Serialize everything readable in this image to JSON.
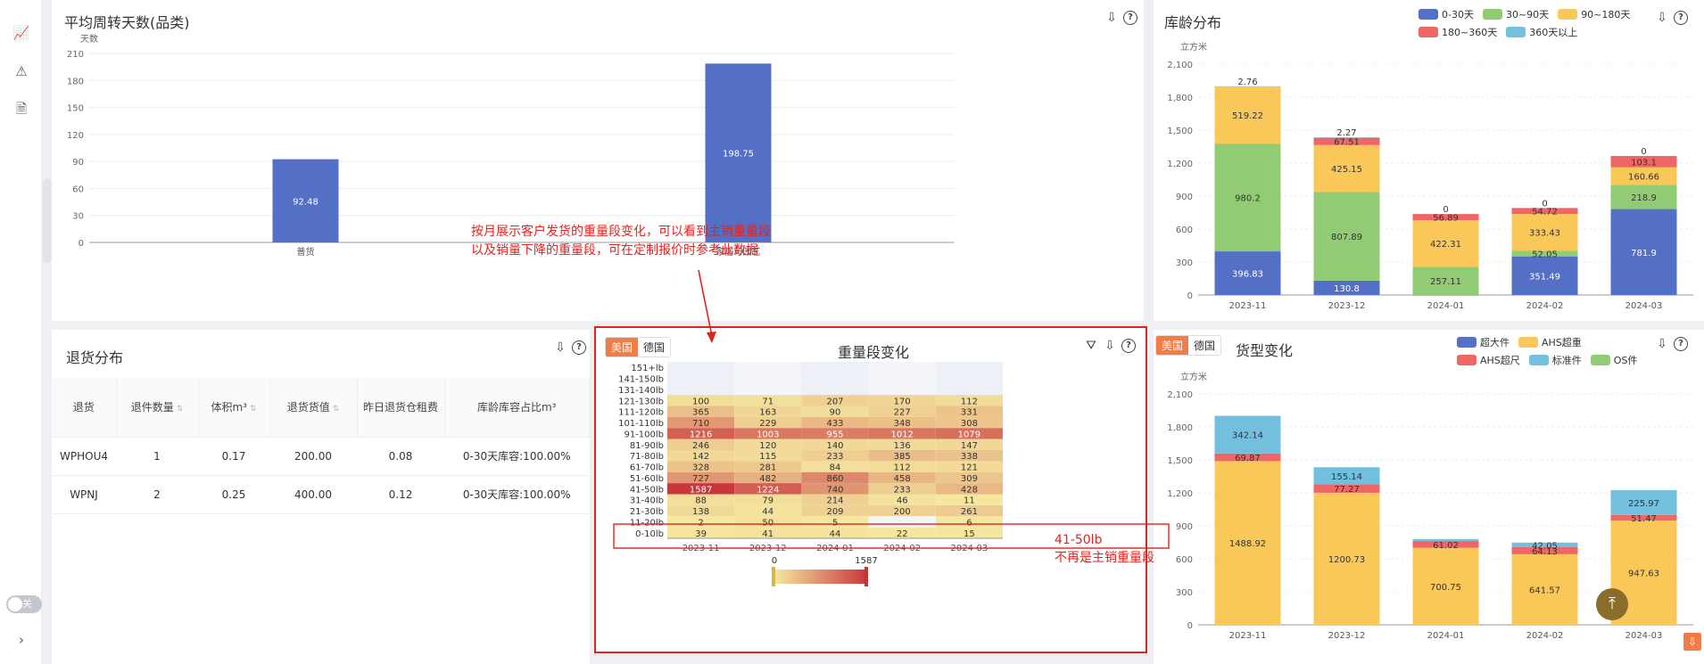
{
  "sidebar": {
    "toggle_label": "关",
    "icons": [
      "line-chart-icon",
      "alert-icon",
      "report-icon",
      "expand-icon"
    ]
  },
  "turnover": {
    "title": "平均周转天数(品类)",
    "ylabel": "天数"
  },
  "aging": {
    "title": "库龄分布",
    "ylabel": "立方米"
  },
  "returns": {
    "title": "退货分布",
    "columns": [
      "退货",
      "退件数量",
      "体积m³",
      "退货货值",
      "昨日退货仓租费",
      "库龄库容占比m³"
    ],
    "rows": [
      [
        "WPHOU4",
        "1",
        "0.17",
        "200.00",
        "0.08",
        "0-30天库容:100.00%"
      ],
      [
        "WPNJ",
        "2",
        "0.25",
        "400.00",
        "0.12",
        "0-30天库容:100.00%"
      ]
    ]
  },
  "weight": {
    "title": "重量段变化",
    "tabs": [
      "美国",
      "德国"
    ],
    "scale_min": "0",
    "scale_max": "1587"
  },
  "cargo": {
    "title": "货型变化",
    "tabs": [
      "美国",
      "德国"
    ],
    "ylabel": "立方米"
  },
  "annotations": {
    "main": "按月展示客户发货的重量段变化，可以看到主销重量段\n以及销量下降的重量段，可在定制报价时参考此数据",
    "side": "41-50lb\n不再是主销重量段"
  },
  "chart_data": [
    {
      "id": "turnover",
      "type": "bar",
      "title": "平均周转天数(品类)",
      "ylabel": "天数",
      "categories": [
        "普货",
        "家居与园艺"
      ],
      "values": [
        92.48,
        198.75
      ],
      "ylim": [
        0,
        210
      ],
      "ticks": [
        0,
        30,
        60,
        90,
        120,
        150,
        180,
        210
      ],
      "color": "#5470c6"
    },
    {
      "id": "aging",
      "type": "bar",
      "stacked": true,
      "title": "库龄分布",
      "ylabel": "立方米",
      "categories": [
        "2023-11",
        "2023-12",
        "2024-01",
        "2024-02",
        "2024-03"
      ],
      "ylim": [
        0,
        2100
      ],
      "ticks": [
        0,
        300,
        600,
        900,
        1200,
        1500,
        1800,
        2100
      ],
      "series": [
        {
          "name": "0-30天",
          "color": "#5470c6",
          "values": [
            396.83,
            130.8,
            0.35,
            351.49,
            781.9
          ]
        },
        {
          "name": "30~90天",
          "color": "#91cc75",
          "values": [
            980.2,
            807.89,
            257.11,
            52.05,
            218.9
          ]
        },
        {
          "name": "90~180天",
          "color": "#fac858",
          "values": [
            519.22,
            425.15,
            422.31,
            333.43,
            160.66
          ]
        },
        {
          "name": "180~360天",
          "color": "#ee6666",
          "values": [
            0,
            67.51,
            56.89,
            54.72,
            103.1
          ]
        },
        {
          "name": "360天以上",
          "color": "#73c0de",
          "values": [
            2.76,
            2.27,
            0,
            0,
            0
          ]
        }
      ],
      "top_labels": [
        "2.76",
        "2.27",
        "0",
        "0",
        "0"
      ]
    },
    {
      "id": "weight",
      "type": "heatmap",
      "title": "重量段变化",
      "x": [
        "2023-11",
        "2023-12",
        "2024-01",
        "2024-02",
        "2024-03"
      ],
      "y": [
        "151+lb",
        "141-150lb",
        "131-140lb",
        "121-130lb",
        "111-120lb",
        "101-110lb",
        "91-100lb",
        "81-90lb",
        "71-80lb",
        "61-70lb",
        "51-60lb",
        "41-50lb",
        "31-40lb",
        "21-30lb",
        "11-20lb",
        "0-10lb"
      ],
      "values": [
        [
          null,
          null,
          null,
          null,
          null
        ],
        [
          null,
          null,
          null,
          null,
          null
        ],
        [
          null,
          null,
          null,
          null,
          null
        ],
        [
          100,
          71,
          207,
          170,
          112
        ],
        [
          365,
          163,
          90,
          227,
          331
        ],
        [
          710,
          229,
          433,
          348,
          308
        ],
        [
          1216,
          1003,
          955,
          1012,
          1079
        ],
        [
          246,
          120,
          140,
          136,
          147
        ],
        [
          142,
          115,
          233,
          385,
          338
        ],
        [
          328,
          281,
          84,
          112,
          121
        ],
        [
          727,
          482,
          860,
          458,
          309
        ],
        [
          1587,
          1224,
          740,
          233,
          428
        ],
        [
          88,
          79,
          214,
          46,
          11
        ],
        [
          138,
          44,
          209,
          200,
          261
        ],
        [
          2,
          50,
          5,
          null,
          6
        ],
        [
          39,
          41,
          44,
          22,
          15
        ]
      ],
      "min": 0,
      "max": 1587
    },
    {
      "id": "cargo",
      "type": "bar",
      "stacked": true,
      "title": "货型变化",
      "ylabel": "立方米",
      "categories": [
        "2023-11",
        "2023-12",
        "2024-01",
        "2024-02",
        "2024-03"
      ],
      "ylim": [
        0,
        2100
      ],
      "ticks": [
        0,
        300,
        600,
        900,
        1200,
        1500,
        1800,
        2100
      ],
      "series": [
        {
          "name": "超大件",
          "color": "#5470c6",
          "values": [
            0,
            0,
            0,
            0,
            0
          ]
        },
        {
          "name": "AHS超重",
          "color": "#fac858",
          "values": [
            1488.92,
            1200.73,
            700.75,
            641.57,
            947.63
          ]
        },
        {
          "name": "AHS超尺",
          "color": "#ee6666",
          "values": [
            69.87,
            77.27,
            61.02,
            64.13,
            51.47
          ]
        },
        {
          "name": "标准件",
          "color": "#73c0de",
          "values": [
            342.14,
            155.14,
            18.34,
            42.05,
            225.97
          ]
        },
        {
          "name": "OS件",
          "color": "#91cc75",
          "values": [
            0,
            0,
            0,
            0,
            0
          ]
        }
      ]
    }
  ]
}
